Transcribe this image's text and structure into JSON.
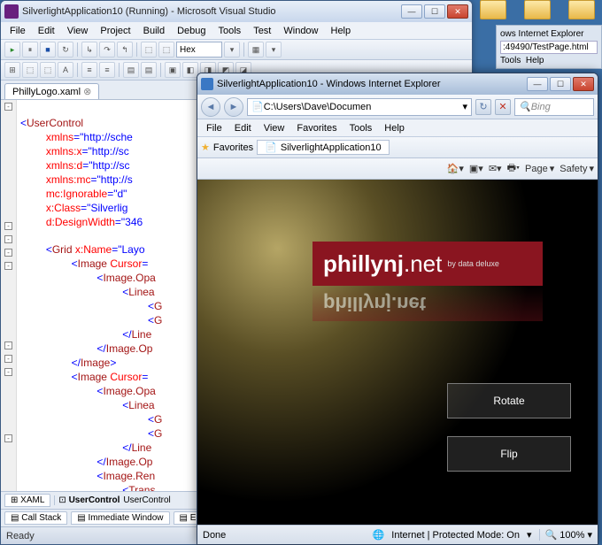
{
  "vs": {
    "title": "SilverlightApplication10 (Running) - Microsoft Visual Studio",
    "menu": [
      "File",
      "Edit",
      "View",
      "Project",
      "Build",
      "Debug",
      "Tools",
      "Test",
      "Window",
      "Help"
    ],
    "hex_label": "Hex",
    "doc_tab": "PhillyLogo.xaml",
    "breadcrumb_xaml": "XAML",
    "breadcrumb_uc1": "UserControl",
    "breadcrumb_uc2": "UserControl",
    "panel_callstack": "Call Stack",
    "panel_immediate": "Immediate Window",
    "panel_errorlist": "Error List",
    "status": "Ready",
    "code": {
      "l1a": "<",
      "l1b": "UserControl",
      "l2a": "xmlns",
      "l2b": "=\"http://sche",
      "l3a": "xmlns",
      "l3b": ":",
      "l3c": "x",
      "l3d": "=\"http://sc",
      "l4a": "xmlns",
      "l4b": ":",
      "l4c": "d",
      "l4d": "=\"http://sc",
      "l5a": "xmlns",
      "l5b": ":",
      "l5c": "mc",
      "l5d": "=\"http://s",
      "l6a": "mc",
      "l6b": ":",
      "l6c": "Ignorable",
      "l6d": "=\"d\"",
      "l7a": "x",
      "l7b": ":",
      "l7c": "Class",
      "l7d": "=\"Silverlig",
      "l8a": "d",
      "l8b": ":",
      "l8c": "DesignWidth",
      "l8d": "=\"346",
      "l10a": "<",
      "l10b": "Grid",
      "l10c": " x",
      "l10d": ":",
      "l10e": "Name",
      "l10f": "=\"Layo",
      "l11a": "<",
      "l11b": "Image",
      "l11c": " Cursor",
      "l11d": "=",
      "l12a": "<",
      "l12b": "Image.Opa",
      "l13a": "<",
      "l13b": "Linea",
      "l14a": "<",
      "l14b": "G",
      "l15a": "<",
      "l15b": "G",
      "l16a": "</",
      "l16b": "Line",
      "l17a": "</",
      "l17b": "Image.Op",
      "l18a": "</",
      "l18b": "Image",
      "l18c": ">",
      "l19a": "<",
      "l19b": "Image",
      "l19c": " Cursor",
      "l19d": "=",
      "l20a": "<",
      "l20b": "Image.Opa",
      "l21a": "<",
      "l21b": "Linea",
      "l22a": "<",
      "l22b": "G",
      "l23a": "<",
      "l23b": "G",
      "l24a": "</",
      "l24b": "Line",
      "l25a": "</",
      "l25b": "Image.Op",
      "l26a": "<",
      "l26b": "Image.Ren",
      "l27a": "<",
      "l27b": "Trans"
    }
  },
  "ie": {
    "title": "SilverlightApplication10 - Windows Internet Explorer",
    "url": "C:\\Users\\Dave\\Documen",
    "search_placeholder": "Bing",
    "menu": [
      "File",
      "Edit",
      "View",
      "Favorites",
      "Tools",
      "Help"
    ],
    "fav_label": "Favorites",
    "tab_label": "SilverlightApplication10",
    "cmd_page": "Page",
    "cmd_safety": "Safety",
    "logo_main": "phillynj",
    "logo_tld": ".net",
    "logo_sub": "by data deluxe",
    "logo_reflect": "phillynj.net",
    "btn_rotate": "Rotate",
    "btn_flip": "Flip",
    "status_done": "Done",
    "status_zone": "Internet | Protected Mode: On",
    "status_zoom": "100%"
  },
  "bg": {
    "url_frag": ":49490/TestPage.html",
    "tools": "Tools",
    "help": "Help",
    "ie_label": "ows Internet Explorer"
  }
}
